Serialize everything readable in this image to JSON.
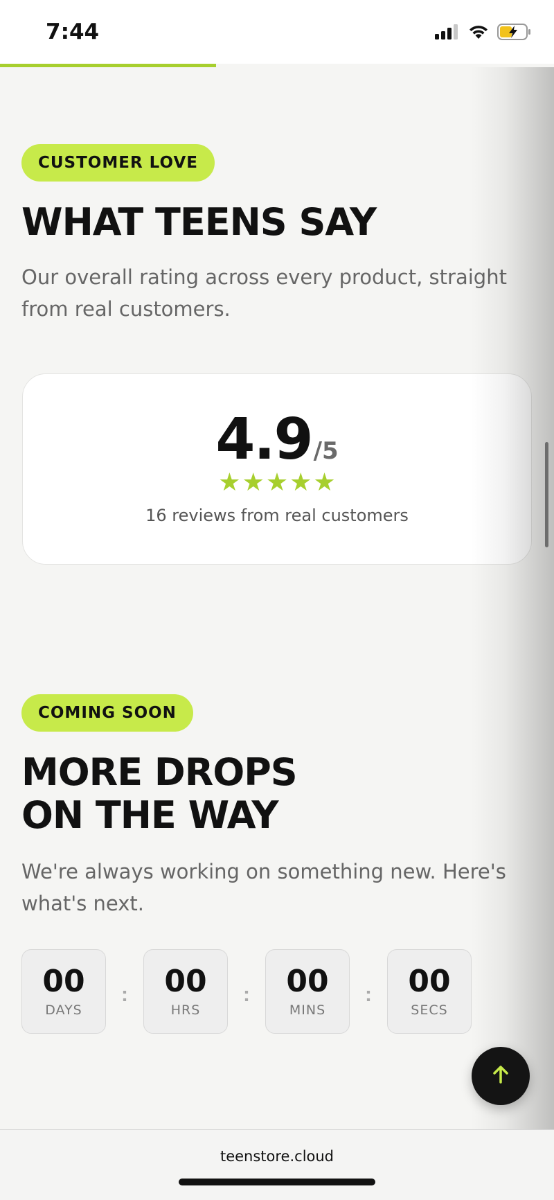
{
  "status_bar": {
    "time": "7:44",
    "icons": [
      "signal-icon",
      "wifi-icon",
      "battery-charging-icon"
    ]
  },
  "scroll_progress": 0.39,
  "reviews": {
    "badge": "CUSTOMER LOVE",
    "title": "WHAT TEENS SAY",
    "description": "Our overall rating across every product, straight from real customers.",
    "rating_value": "4.9",
    "rating_max": "/5",
    "stars": 5,
    "caption": "16 reviews from real customers"
  },
  "upcoming": {
    "badge": "COMING SOON",
    "title_line1": "MORE DROPS",
    "title_line2": "ON THE WAY",
    "description": "We're always working on something new. Here's what's next.",
    "countdown": [
      {
        "value": "00",
        "unit": "DAYS"
      },
      {
        "value": "00",
        "unit": "HRS"
      },
      {
        "value": "00",
        "unit": "MINS"
      },
      {
        "value": "00",
        "unit": "SECS"
      }
    ],
    "separator": ":"
  },
  "fab": {
    "icon": "arrow-up-icon"
  },
  "browser": {
    "url": "teenstore.cloud"
  },
  "colors": {
    "accent": "#c7ea4a",
    "star": "#a7cf2e",
    "text": "#111111",
    "muted": "#666666",
    "background": "#f5f5f3"
  }
}
